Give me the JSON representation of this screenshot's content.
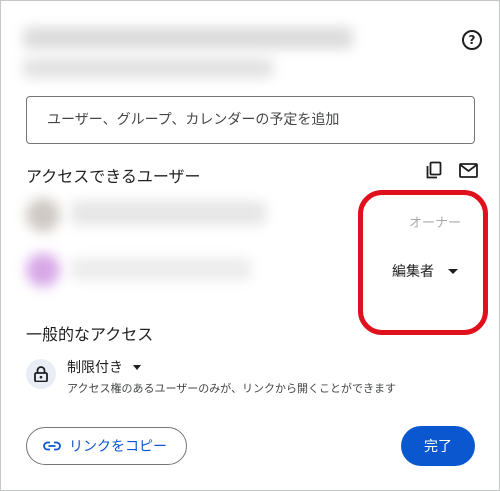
{
  "dialog": {
    "add_people": {
      "placeholder": "ユーザー、グループ、カレンダーの予定を追加"
    },
    "people_section": {
      "title": "アクセスできるユーザー",
      "people": [
        {
          "role": "オーナー"
        },
        {
          "role": "編集者"
        }
      ]
    },
    "general_access": {
      "title": "一般的なアクセス",
      "setting": "制限付き",
      "description": "アクセス権のあるユーザーのみが、リンクから開くことができます"
    },
    "footer": {
      "copy_link_label": "リンクをコピー",
      "done_label": "完了"
    }
  },
  "icons": {
    "help": "help-circle-icon",
    "copy_emails": "copy-icon",
    "email": "mail-icon",
    "lock": "lock-icon",
    "link": "link-icon"
  },
  "colors": {
    "accent": "#0b57d0",
    "highlight": "#e0101c"
  }
}
